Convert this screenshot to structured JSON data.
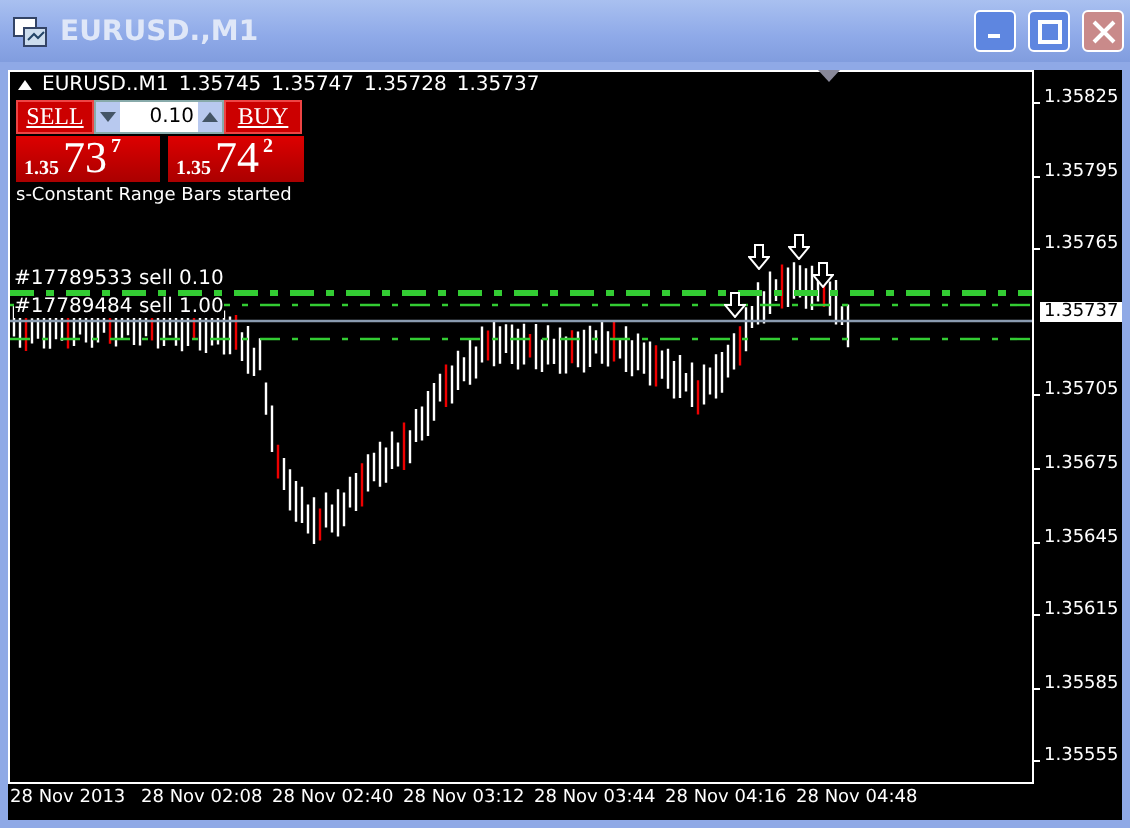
{
  "window": {
    "title": "EURUSD.,M1"
  },
  "chart": {
    "symbol": "EURUSD..M1",
    "ohlc": [
      "1.35745",
      "1.35747",
      "1.35728",
      "1.35737"
    ],
    "trade_panel": {
      "sell_label": "SELL",
      "buy_label": "BUY",
      "lot": "0.10",
      "sell_price": {
        "prefix": "1.35",
        "big": "73",
        "sup": "7"
      },
      "buy_price": {
        "prefix": "1.35",
        "big": "74",
        "sup": "2"
      }
    },
    "status_text": "s-Constant Range Bars started",
    "order_lines": [
      {
        "label": "#17789533 sell 0.10"
      },
      {
        "label": "#17789484 sell 1.00"
      }
    ],
    "current_price": "1.35737",
    "price_axis": [
      "1.35825",
      "1.35795",
      "1.35765",
      "1.35705",
      "1.35675",
      "1.35645",
      "1.35615",
      "1.35585",
      "1.35555"
    ],
    "time_axis": [
      "28 Nov 2013",
      "28 Nov 02:08",
      "28 Nov 02:40",
      "28 Nov 03:12",
      "28 Nov 03:44",
      "28 Nov 04:16",
      "28 Nov 04:48"
    ]
  }
}
